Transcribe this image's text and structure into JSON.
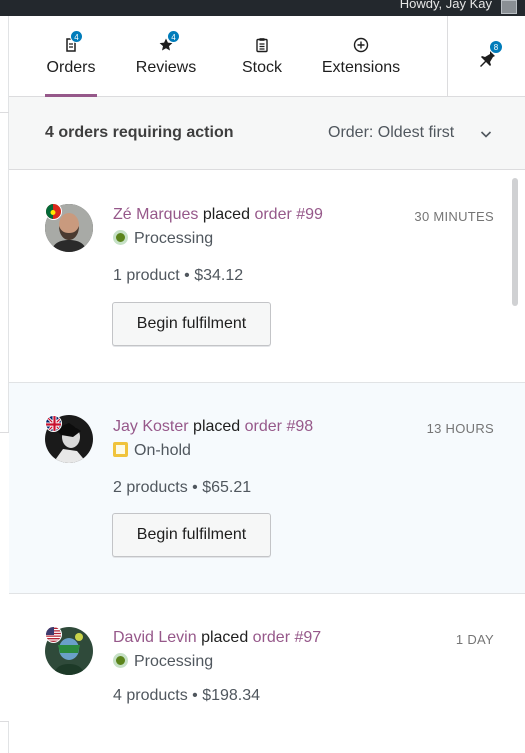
{
  "adminbar": {
    "greeting": "Howdy, Jay Kay"
  },
  "tabs": [
    {
      "label": "Orders",
      "badge": "4",
      "icon": "orders-icon"
    },
    {
      "label": "Reviews",
      "badge": "4",
      "icon": "star-icon"
    },
    {
      "label": "Stock",
      "badge": "",
      "icon": "clipboard-icon"
    },
    {
      "label": "Extensions",
      "badge": "",
      "icon": "plus-circle-icon"
    }
  ],
  "notifications": {
    "badge": "8",
    "icon": "bell-icon"
  },
  "header": {
    "title": "4 orders requiring action",
    "sort_label": "Order: Oldest first"
  },
  "orders": [
    {
      "customer": "Zé Marques",
      "placed": "placed",
      "order_link": "order #99",
      "time": "30 MINUTES",
      "status": "Processing",
      "summary": "1 product • $34.12",
      "button": "Begin fulfilment",
      "flag": "portugal-flag-icon"
    },
    {
      "customer": "Jay Koster",
      "placed": "placed",
      "order_link": "order #98",
      "time": "13 HOURS",
      "status": "On-hold",
      "summary": "2 products • $65.21",
      "button": "Begin fulfilment",
      "flag": "uk-flag-icon"
    },
    {
      "customer": "David Levin",
      "placed": "placed",
      "order_link": "order #97",
      "time": "1 DAY",
      "status": "Processing",
      "summary": "4 products • $198.34",
      "flag": "us-flag-icon"
    }
  ],
  "colors": {
    "accent": "#96588a",
    "badge": "#007cba",
    "processing": "#5b841b",
    "on_hold": "#f0c33c"
  }
}
